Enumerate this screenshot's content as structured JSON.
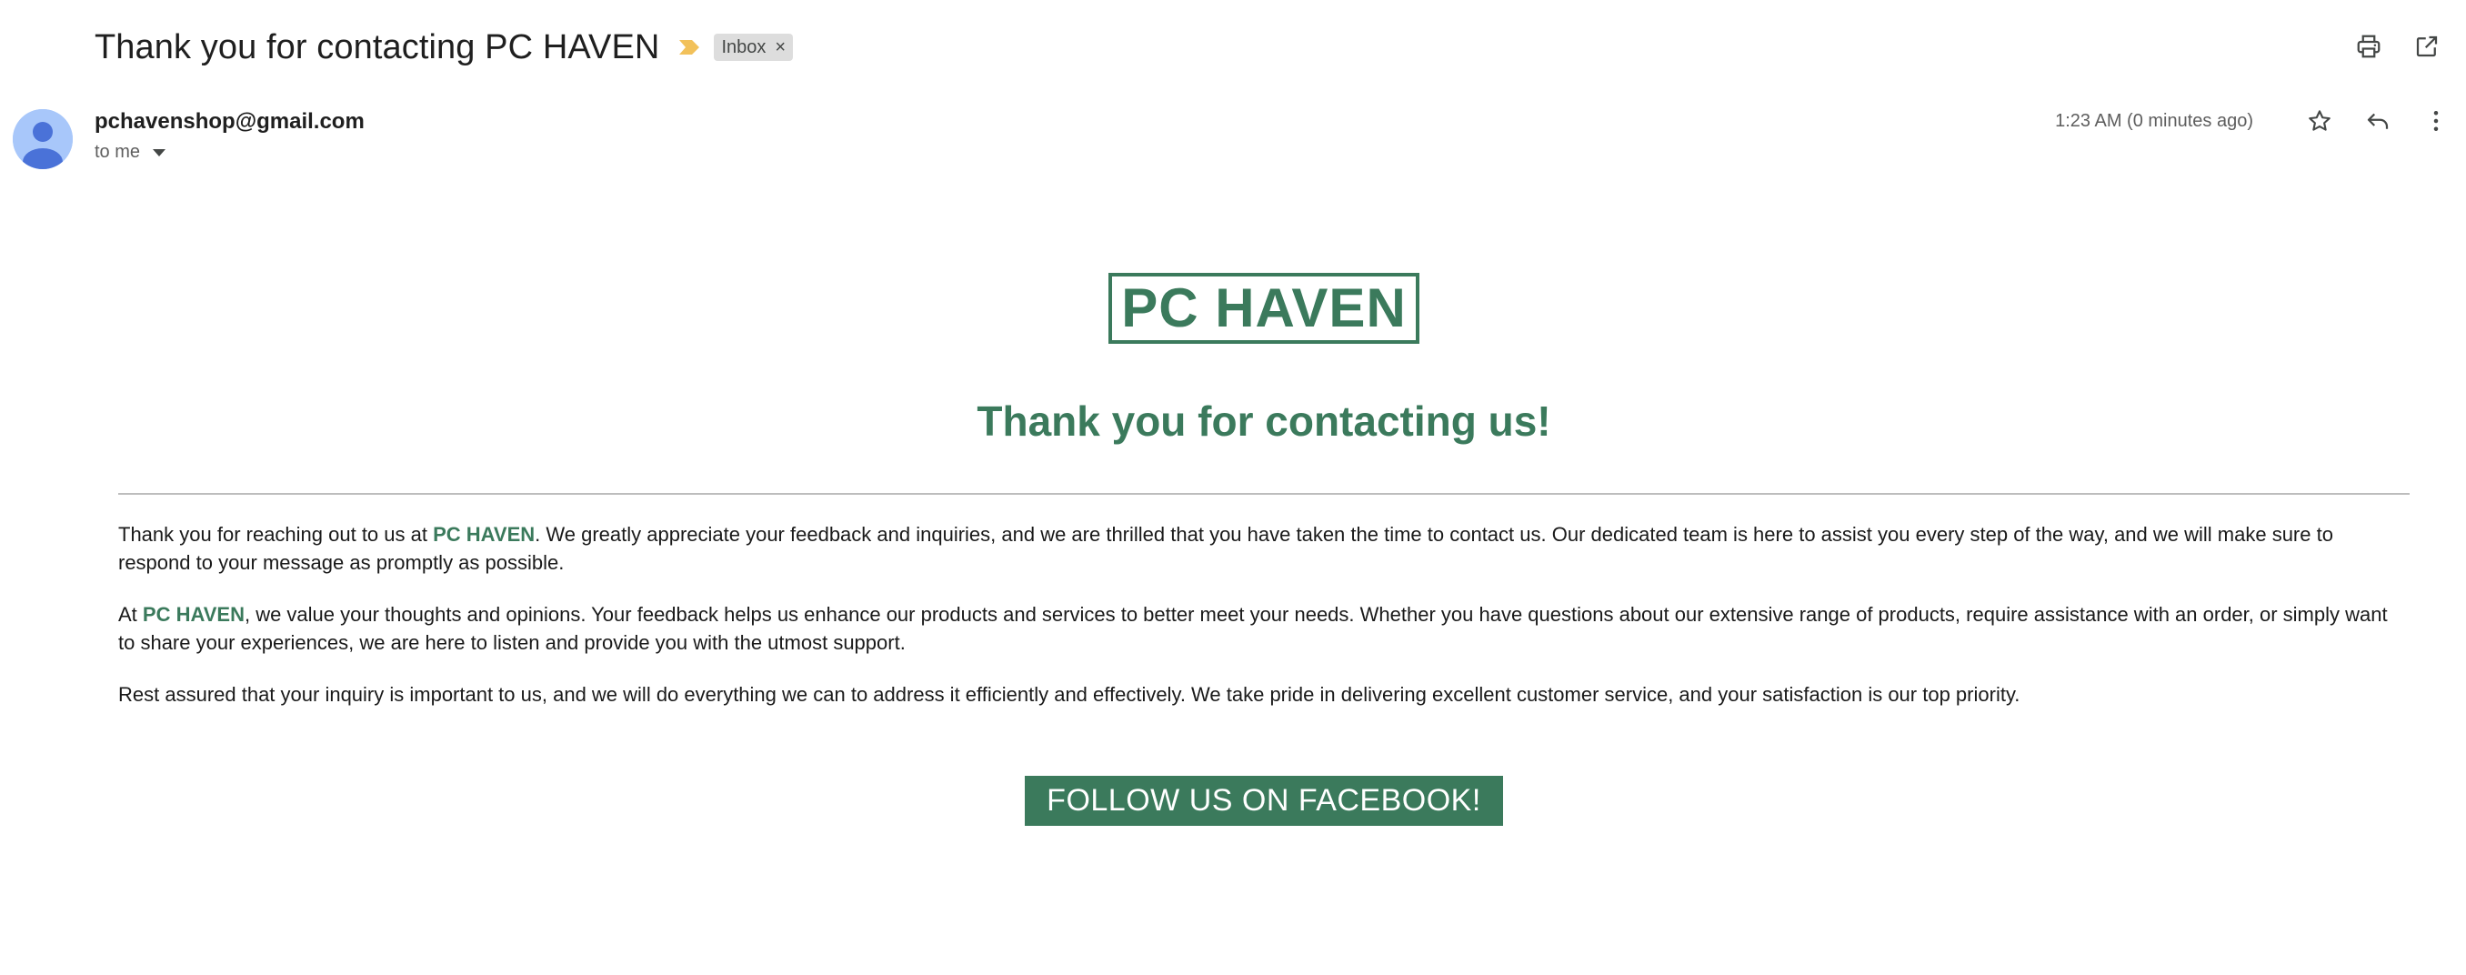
{
  "header": {
    "subject": "Thank you for contacting PC HAVEN",
    "label_chip": "Inbox",
    "label_chip_remove": "×"
  },
  "message": {
    "sender": "pchavenshop@gmail.com",
    "recipient": "to me",
    "timestamp": "1:23 AM (0 minutes ago)"
  },
  "email": {
    "logo": "PC HAVEN",
    "headline": "Thank you for contacting us!",
    "para1_pre": "Thank you for reaching out to us at ",
    "para1_brand": "PC HAVEN",
    "para1_post": ". We greatly appreciate your feedback and inquiries, and we are thrilled that you have taken the time to contact us. Our dedicated team is here to assist you every step of the way, and we will make sure to respond to your message as promptly as possible.",
    "para2_pre": "At ",
    "para2_brand": "PC HAVEN",
    "para2_post": ", we value your thoughts and opinions. Your feedback helps us enhance our products and services to better meet your needs. Whether you have questions about our extensive range of products, require assistance with an order, or simply want to share your experiences, we are here to listen and provide you with the utmost support.",
    "para3": "Rest assured that your inquiry is important to us, and we will do everything we can to address it efficiently and effectively. We take pride in delivering excellent customer service, and your satisfaction is our top priority.",
    "cta": "FOLLOW US ON FACEBOOK!"
  },
  "icons": {
    "importance": "importance-marker-icon",
    "print": "print-icon",
    "open_new_window": "open-in-new-window-icon",
    "star": "star-icon",
    "reply": "reply-icon",
    "more": "more-vert-icon",
    "avatar": "default-avatar-icon"
  },
  "colors": {
    "brand_green": "#3b7a5c",
    "importance_yellow": "#f2c15a",
    "chip_bg": "#dddddd",
    "avatar_bg": "#a8c7fa",
    "avatar_fg": "#4a72d8"
  }
}
